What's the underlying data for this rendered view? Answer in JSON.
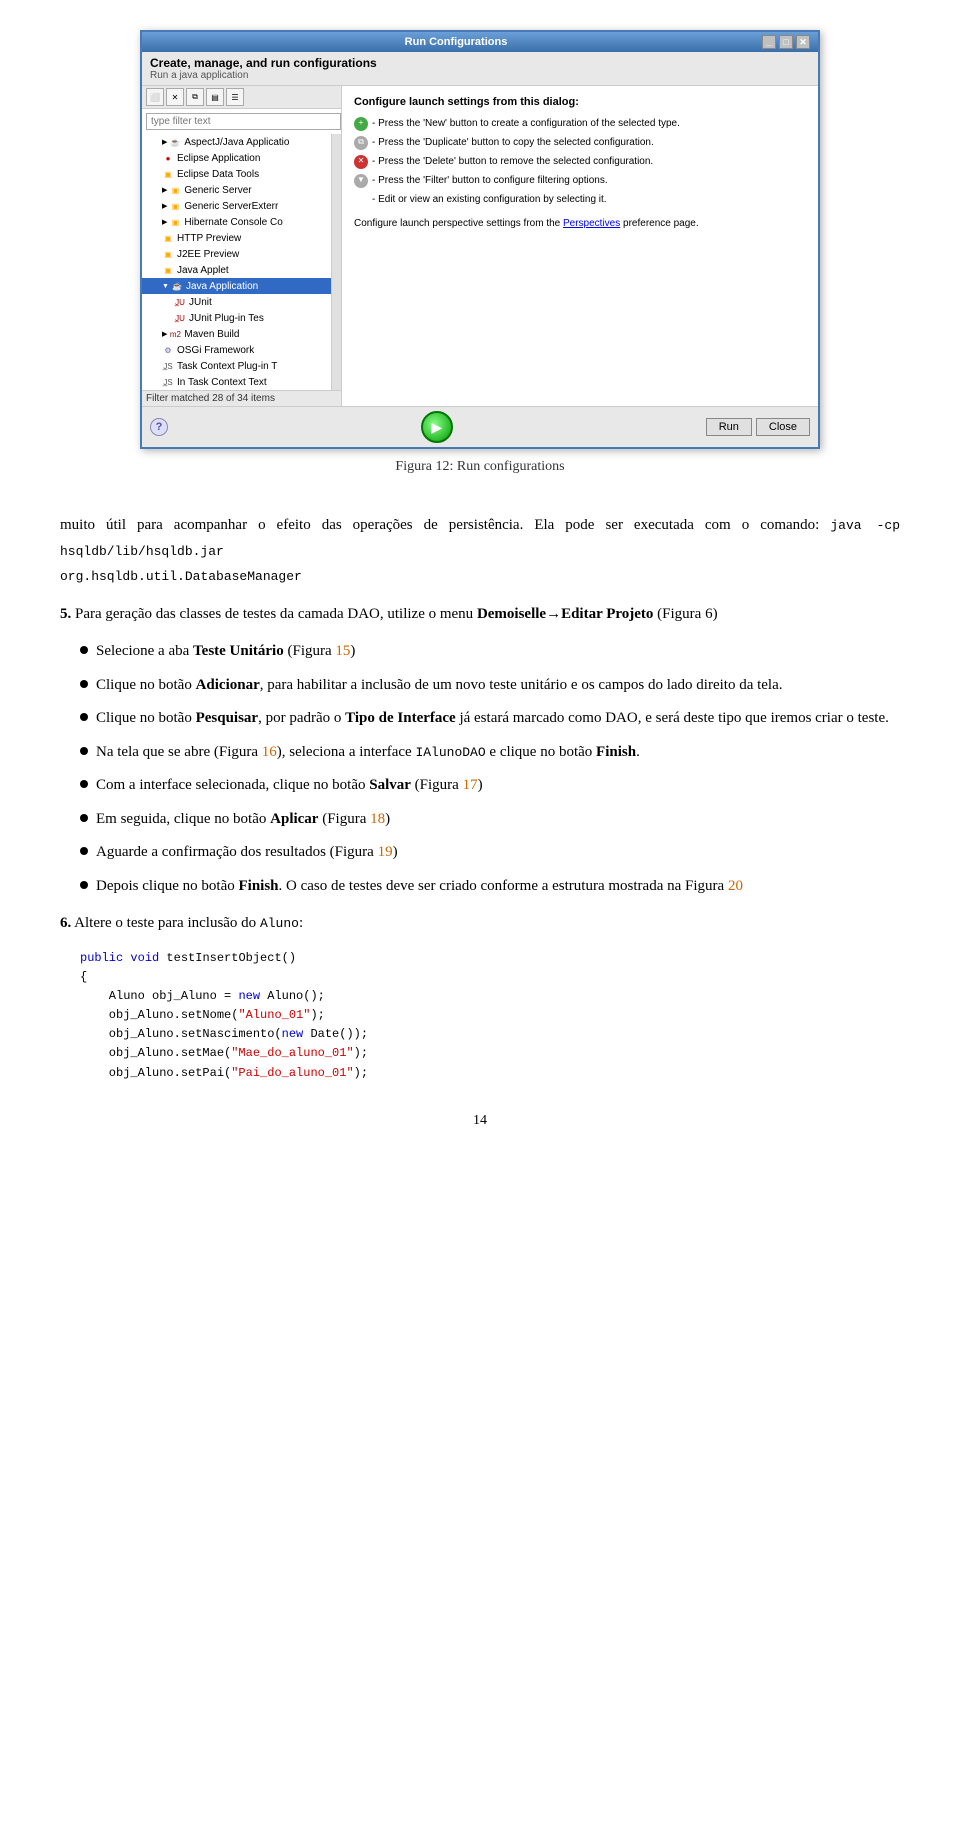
{
  "window": {
    "title": "Run Configurations",
    "subtitle_main": "Create, manage, and run configurations",
    "subtitle_sub": "Run a java application",
    "run_button_label": "▶",
    "close_button_label": "Close",
    "run_btn_label": "Run",
    "help_label": "?",
    "filter_placeholder": "type filter text",
    "filter_status": "Filter matched 28 of 34 items"
  },
  "tree_items": [
    {
      "label": "AspectJ/Java Applicatio",
      "indent": 16,
      "has_arrow": false,
      "icon": "java"
    },
    {
      "label": "Eclipse Application",
      "indent": 16,
      "has_arrow": false,
      "icon": "circle-red"
    },
    {
      "label": "Eclipse Data Tools",
      "indent": 16,
      "has_arrow": false,
      "icon": "folder"
    },
    {
      "label": "Generic Server",
      "indent": 16,
      "has_arrow": true,
      "icon": "folder"
    },
    {
      "label": "Generic ServerExterr",
      "indent": 16,
      "has_arrow": true,
      "icon": "folder"
    },
    {
      "label": "Hibernate Console Co",
      "indent": 16,
      "has_arrow": true,
      "icon": "folder"
    },
    {
      "label": "HTTP Preview",
      "indent": 16,
      "has_arrow": false,
      "icon": "folder"
    },
    {
      "label": "J2EE Preview",
      "indent": 16,
      "has_arrow": false,
      "icon": "folder"
    },
    {
      "label": "Java Applet",
      "indent": 16,
      "has_arrow": false,
      "icon": "folder"
    },
    {
      "label": "Java Application",
      "indent": 16,
      "has_arrow": true,
      "icon": "java",
      "selected": true
    },
    {
      "label": "JUnit",
      "indent": 28,
      "has_arrow": false,
      "icon": "junit"
    },
    {
      "label": "JUnit Plug-in Tes",
      "indent": 28,
      "has_arrow": false,
      "icon": "junit"
    },
    {
      "label": "Maven Build",
      "indent": 16,
      "has_arrow": true,
      "icon": "maven"
    },
    {
      "label": "OSGi Framework",
      "indent": 16,
      "has_arrow": false,
      "icon": "osgi"
    },
    {
      "label": "Task Context Plug-in T",
      "indent": 16,
      "has_arrow": false,
      "icon": "task"
    },
    {
      "label": "In Task Context Text",
      "indent": 16,
      "has_arrow": false,
      "icon": "task"
    }
  ],
  "context_menu": {
    "items": [
      {
        "label": "New",
        "highlighted": true
      },
      {
        "label": "Duplicate",
        "highlighted": false
      },
      {
        "label": "Delete",
        "highlighted": false,
        "disabled": true
      }
    ]
  },
  "right_panel": {
    "configure_title": "Configure launch settings from this dialog:",
    "info_items": [
      {
        "bullet": "new",
        "text": "- Press the 'New' button to create a configuration of the selected type."
      },
      {
        "bullet": "dup",
        "text": "- Press the 'Duplicate' button to copy the selected configuration."
      },
      {
        "bullet": "del",
        "text": "- Press the 'Delete' button to remove the selected configuration."
      },
      {
        "bullet": "flt",
        "text": "- Press the 'Filter' button to configure filtering options."
      },
      {
        "bullet": "none",
        "text": "- Edit or view an existing configuration by selecting it."
      }
    ],
    "perspective_text": "Configure launch perspective settings from the",
    "perspective_link": "Perspectives",
    "perspective_suffix": "preference page."
  },
  "figure": {
    "caption": "Figura 12: Run configurations"
  },
  "paragraphs": [
    {
      "id": "p1",
      "text": "muito útil para acompanhar o efeito das operações de persistência. Ela pode ser executada com o comando: "
    }
  ],
  "code_inline": {
    "command1": "java -cp hsqldb/lib/hsqldb.jar",
    "command2": "org.hsqldb.util.DatabaseManager"
  },
  "section5_text": "5.",
  "section5_content": "Para geração das classes de testes da camada DAO, utilize o menu ",
  "section5_bold1": "Demoiselle→Editar Projeto",
  "section5_paren": " (Figura 6)",
  "bullet_items": [
    {
      "id": "b1",
      "text": "Selecione a aba ",
      "bold": "Teste Unitário",
      "suffix": " (Figura 15)"
    },
    {
      "id": "b2",
      "text": "Clique no botão ",
      "bold": "Adicionar",
      "suffix": ", para habilitar a inclusão de um novo teste unitário e os campos do lado direito da tela."
    },
    {
      "id": "b3",
      "text": "Clique no botão ",
      "bold": "Pesquisar",
      "suffix": ", por padrão o ",
      "bold2": "Tipo de Interface",
      "suffix2": " já estará marcado como DAO, e será deste tipo que iremos criar o teste."
    },
    {
      "id": "b4",
      "text": "Na tela que se abre (Figura 16), seleciona a interface ",
      "code": "IAlunoDAO",
      "suffix": " e clique no botão ",
      "bold": "Finish",
      "suffix2": "."
    },
    {
      "id": "b5",
      "text": "Com a interface selecionada, clique no botão ",
      "bold": "Salvar",
      "suffix": " (Figura 17)"
    },
    {
      "id": "b6",
      "text": "Em seguida, clique no botão ",
      "bold": "Aplicar",
      "suffix": " (Figura 18)"
    },
    {
      "id": "b7",
      "text": "Aguarde a confirmação dos resultados (Figura 19)"
    },
    {
      "id": "b8",
      "text": "Depois clique no botão ",
      "bold": "Finish",
      "suffix": "."
    }
  ],
  "b8_suffix": " O caso de testes deve ser criado conforme a estrutura mostrada na Figura 20",
  "section6_text": "6.",
  "section6_content": "Altere o teste para inclusão do ",
  "section6_code": "Aluno",
  "code_block": {
    "lines": [
      {
        "type": "normal",
        "text": "public void testInsertObject()"
      },
      {
        "type": "normal",
        "text": "{"
      },
      {
        "type": "indent",
        "text": "Aluno obj_Aluno = new Aluno();"
      },
      {
        "type": "indent",
        "text": "obj_Aluno.setNome(\"Aluno_01\");"
      },
      {
        "type": "indent",
        "text": "obj_Aluno.setNascimento(new Date());"
      },
      {
        "type": "indent",
        "text": "obj_Aluno.setMae(\"Mae_do_aluno_01\");"
      },
      {
        "type": "indent",
        "text": "obj_Aluno.setPai(\"Pai_do_aluno_01\");"
      }
    ]
  },
  "page_number": "14",
  "orange_refs": [
    "15",
    "16",
    "17",
    "18",
    "19",
    "20"
  ]
}
